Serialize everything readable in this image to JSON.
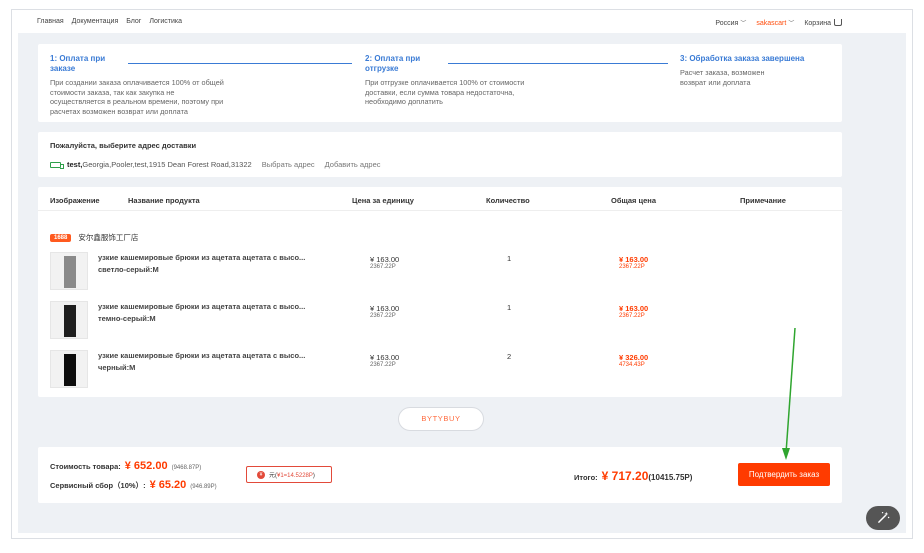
{
  "nav": {
    "links": [
      "Главная",
      "Документация",
      "Блог",
      "Логистика"
    ],
    "country": "Россия",
    "brand": "sakascart",
    "cart": "Корзина"
  },
  "steps": [
    {
      "title": "1:  Оплата при заказе",
      "desc": "При создании заказа оплачивается 100% от общей стоимости заказа, так как закупка не осуществляется в реальном времени, поэтому при расчетах возможен возврат или доплата"
    },
    {
      "title": "2:  Оплата при отгрузке",
      "desc": "При отгрузке оплачивается 100% от стоимости доставки, если сумма товара недостаточна, необходимо доплатить"
    },
    {
      "title": "3:  Обработка заказа завершена",
      "desc": "Расчет заказа, возможен возврат или доплата"
    }
  ],
  "address": {
    "title": "Пожалуйста, выберите адрес доставки",
    "name": "test,",
    "line": "Georgia,Pooler,test,1915 Dean Forest Road,31322",
    "select_link": "Выбрать адрес",
    "add_link": "Добавить адрес"
  },
  "table": {
    "headers": [
      "Изображение",
      "Название продукта",
      "Цена за единицу",
      "Количество",
      "Общая цена",
      "Примечание"
    ],
    "shop_badge": "1688",
    "shop_name": "安尔鑫服饰工厂店",
    "rows": [
      {
        "name": "узкие кашемировые брюки из ацетата ацетата с высо...",
        "variant": "светло-серый:M",
        "price": "¥ 163.00",
        "price_rub": "2367.22P",
        "qty": "1",
        "total": "¥ 163.00",
        "total_rub": "2367.22P",
        "color": "#8a8a8a"
      },
      {
        "name": "узкие кашемировые брюки из ацетата ацетата с высо...",
        "variant": "темно-серый:M",
        "price": "¥ 163.00",
        "price_rub": "2367.22P",
        "qty": "1",
        "total": "¥ 163.00",
        "total_rub": "2367.22P",
        "color": "#1f1f1f"
      },
      {
        "name": "узкие кашемировые брюки из ацетата ацетата с высо...",
        "variant": "черный:M",
        "price": "¥ 163.00",
        "price_rub": "2367.22P",
        "qty": "2",
        "total": "¥ 326.00",
        "total_rub": "4734.43P",
        "color": "#0d0d0d"
      }
    ]
  },
  "logo_text": "BYTYBUY",
  "summary": {
    "goods_label": "Стоимость товара:",
    "goods_value": "¥ 652.00",
    "goods_rub": "(9468.87P)",
    "service_label": "Сервисный сбор（10%）:",
    "service_value": "¥ 65.20",
    "service_rub": "(946.89P)",
    "coupon_prefix": "元(",
    "coupon_rate": "¥1=14.5228P",
    "coupon_suffix": ")",
    "total_label": "Итого:",
    "total_value": "¥ 717.20",
    "total_rub": "(10415.75P)",
    "confirm_label": "Подтвердить заказ"
  },
  "colors": {
    "accent": "#ff3b00",
    "step_blue": "#3a7bd5",
    "arrow_green": "#2fa52f"
  }
}
